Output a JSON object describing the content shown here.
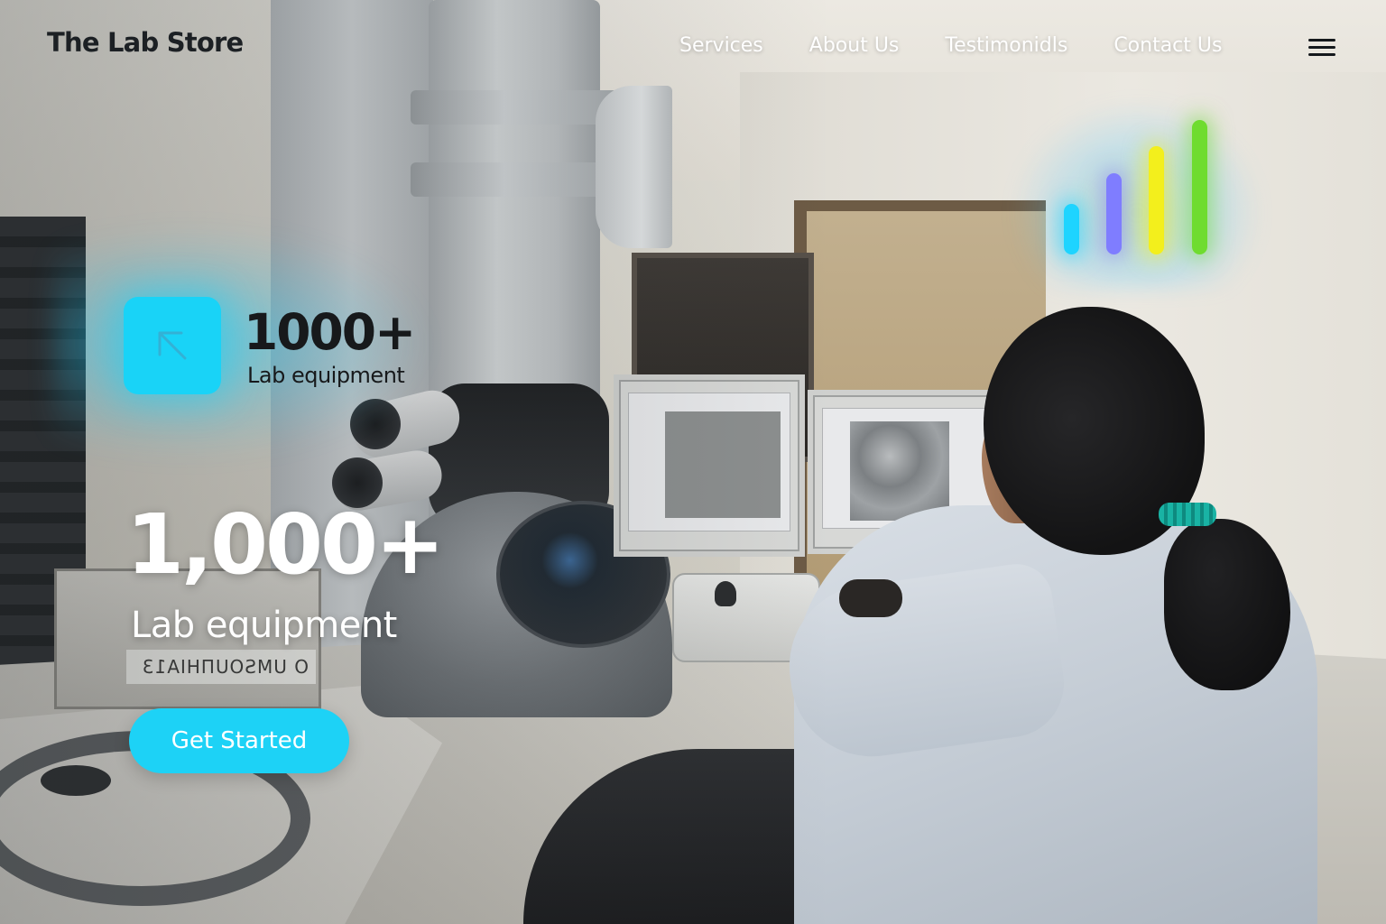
{
  "header": {
    "brand": "The Lab Store",
    "nav": [
      {
        "label": "Services"
      },
      {
        "label": "About Us"
      },
      {
        "label": "Testimonidls"
      },
      {
        "label": "Contact Us"
      }
    ],
    "menu_icon": "hamburger-menu-icon"
  },
  "stat_card": {
    "icon": "arrow-up-left-icon",
    "number": "1000+",
    "label": "Lab equipment"
  },
  "hero": {
    "number": "1,000+",
    "label": "Lab equipment",
    "cta_label": "Get Started"
  },
  "background": {
    "equipment_label": "O UMSOUПHIA13"
  },
  "colors": {
    "accent": "#1dd2f6",
    "bar_cyan": "#1ed4ff",
    "bar_violet": "#7f7dff",
    "bar_yellow": "#f3ef1c",
    "bar_green": "#6fdc2f",
    "brand_text": "#1c2024"
  }
}
